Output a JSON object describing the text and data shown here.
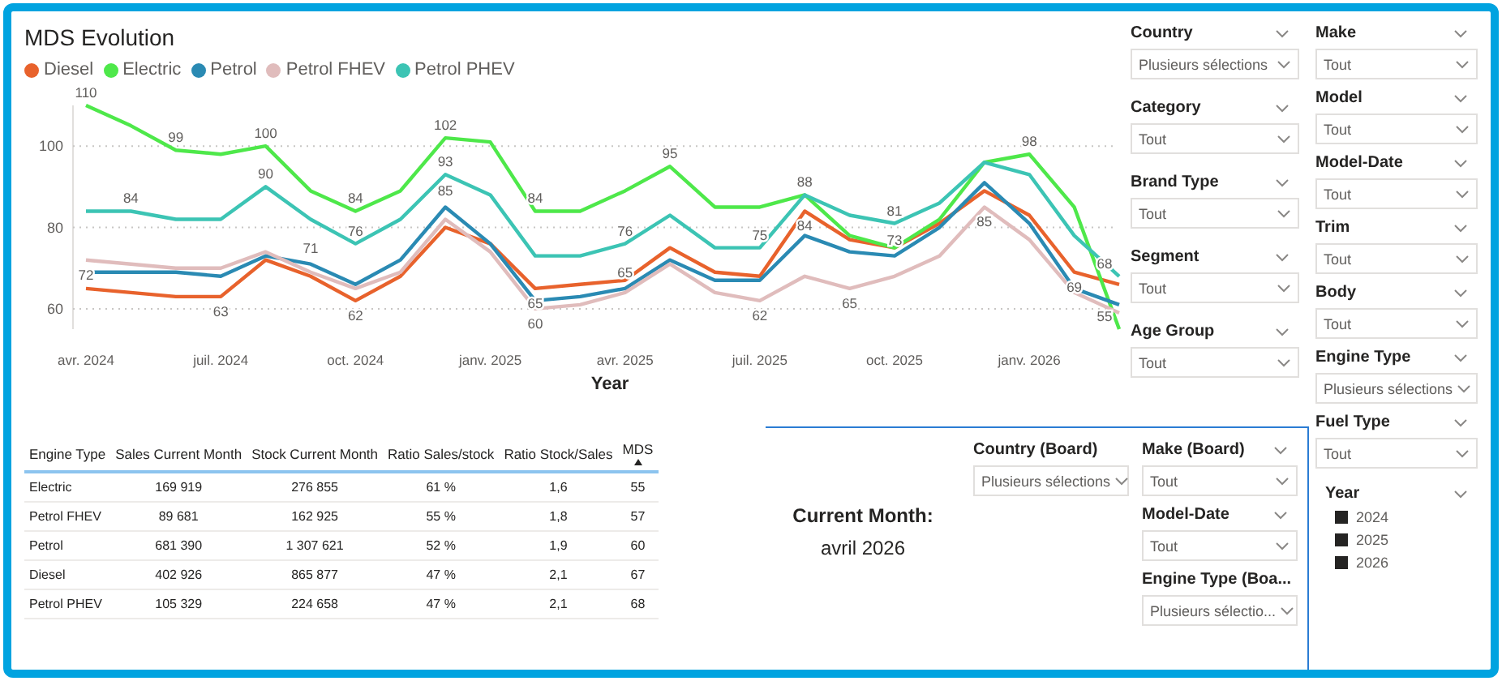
{
  "chart": {
    "title": "MDS Evolution",
    "chart_data": {
      "type": "line",
      "xlabel": "Year",
      "categories": [
        "avr. 2024",
        null,
        null,
        "juil. 2024",
        null,
        null,
        "oct. 2024",
        null,
        null,
        "janv. 2025",
        null,
        null,
        "avr. 2025",
        null,
        null,
        "juil. 2025",
        null,
        null,
        "oct. 2025",
        null,
        null,
        "janv. 2026",
        null,
        null
      ],
      "yticks": [
        60,
        80,
        100
      ],
      "ylim": [
        55,
        110
      ],
      "grid": true,
      "series": [
        {
          "name": "Diesel",
          "color": "#e8622c",
          "values": [
            65,
            64,
            63,
            63,
            72,
            68,
            62,
            68,
            80,
            76,
            65,
            66,
            67,
            75,
            69,
            68,
            84,
            77,
            75,
            81,
            89,
            83,
            69,
            66
          ],
          "value_labels": [
            null,
            null,
            null,
            "63",
            null,
            null,
            "62",
            null,
            null,
            null,
            "65",
            null,
            null,
            null,
            null,
            null,
            "84",
            null,
            null,
            null,
            null,
            null,
            "69",
            null
          ]
        },
        {
          "name": "Electric",
          "color": "#4ee84a",
          "values": [
            110,
            105,
            99,
            98,
            100,
            89,
            84,
            89,
            102,
            101,
            84,
            84,
            89,
            95,
            85,
            85,
            88,
            78,
            75,
            82,
            96,
            98,
            85,
            55
          ],
          "value_labels": [
            "110",
            null,
            "99",
            null,
            "100",
            null,
            "84",
            null,
            "102",
            null,
            "84",
            null,
            null,
            "95",
            null,
            null,
            "88",
            null,
            null,
            null,
            null,
            "98",
            null,
            "55"
          ]
        },
        {
          "name": "Petrol",
          "color": "#2a8ab3",
          "values": [
            69,
            69,
            69,
            68,
            73,
            71,
            66,
            72,
            85,
            76,
            62,
            63,
            65,
            72,
            67,
            67,
            78,
            74,
            73,
            80,
            91,
            81,
            65,
            61
          ],
          "value_labels": [
            null,
            null,
            null,
            null,
            null,
            "71",
            null,
            null,
            "85",
            null,
            null,
            null,
            "65",
            null,
            null,
            null,
            null,
            null,
            "73",
            null,
            null,
            null,
            null,
            null
          ]
        },
        {
          "name": "Petrol FHEV",
          "color": "#e0bcbc",
          "values": [
            72,
            71,
            70,
            70,
            74,
            69,
            65,
            69,
            82,
            74,
            60,
            61,
            64,
            71,
            64,
            62,
            68,
            65,
            68,
            73,
            85,
            77,
            64,
            59
          ],
          "value_labels": [
            "72",
            null,
            null,
            null,
            null,
            null,
            null,
            null,
            null,
            null,
            "60",
            null,
            null,
            null,
            null,
            "62",
            null,
            "65",
            null,
            null,
            "85",
            null,
            null,
            null
          ]
        },
        {
          "name": "Petrol PHEV",
          "color": "#3cc4b4",
          "values": [
            84,
            84,
            82,
            82,
            90,
            82,
            76,
            82,
            93,
            88,
            73,
            73,
            76,
            83,
            75,
            75,
            88,
            83,
            81,
            86,
            96,
            93,
            78,
            68
          ],
          "value_labels": [
            null,
            "84",
            null,
            null,
            "90",
            null,
            "76",
            null,
            "93",
            null,
            null,
            null,
            "76",
            null,
            null,
            "75",
            null,
            null,
            "81",
            null,
            null,
            null,
            null,
            "68"
          ]
        }
      ]
    }
  },
  "table": {
    "columns": [
      {
        "label": "Engine Type",
        "sorted": false
      },
      {
        "label": "Sales Current Month",
        "sorted": false
      },
      {
        "label": "Stock Current Month",
        "sorted": false
      },
      {
        "label": "Ratio Sales/stock",
        "sorted": false
      },
      {
        "label": "Ratio Stock/Sales",
        "sorted": false
      },
      {
        "label": "MDS",
        "sorted": true
      }
    ],
    "rows": [
      [
        "Electric",
        "169 919",
        "276 855",
        "61 %",
        "1,6",
        "55"
      ],
      [
        "Petrol FHEV",
        "89 681",
        "162 925",
        "55 %",
        "1,8",
        "57"
      ],
      [
        "Petrol",
        "681 390",
        "1 307 621",
        "52 %",
        "1,9",
        "60"
      ],
      [
        "Diesel",
        "402 926",
        "865 877",
        "47 %",
        "2,1",
        "67"
      ],
      [
        "Petrol PHEV",
        "105 329",
        "224 658",
        "47 %",
        "2,1",
        "68"
      ]
    ]
  },
  "current_month": {
    "label": "Current Month:",
    "value": "avril 2026"
  },
  "board_filters": [
    {
      "label": "Country (Board)",
      "value": "Plusieurs sélections",
      "chevron": false
    },
    {
      "label": "Make (Board)",
      "value": "Tout",
      "chevron": true
    },
    {
      "label": "Model-Date",
      "value": "Tout",
      "chevron": true
    },
    {
      "label": "Engine Type (Boa...",
      "value": "Plusieurs sélectio...",
      "chevron": false
    }
  ],
  "filters_left": [
    {
      "label": "Country",
      "value": "Plusieurs sélections",
      "chevron": true
    },
    {
      "label": "Category",
      "value": "Tout",
      "chevron": true
    },
    {
      "label": "Brand Type",
      "value": "Tout",
      "chevron": true
    },
    {
      "label": "Segment",
      "value": "Tout",
      "chevron": true
    },
    {
      "label": "Age Group",
      "value": "Tout",
      "chevron": true
    }
  ],
  "filters_right": [
    {
      "label": "Make",
      "value": "Tout",
      "chevron": true
    },
    {
      "label": "Model",
      "value": "Tout",
      "chevron": true
    },
    {
      "label": "Model-Date",
      "value": "Tout",
      "chevron": true
    },
    {
      "label": "Trim",
      "value": "Tout",
      "chevron": true
    },
    {
      "label": "Body",
      "value": "Tout",
      "chevron": true
    },
    {
      "label": "Engine Type",
      "value": "Plusieurs sélections",
      "chevron": true
    },
    {
      "label": "Fuel Type",
      "value": "Tout",
      "chevron": true
    }
  ],
  "year_filter": {
    "label": "Year",
    "chevron": true,
    "items": [
      {
        "label": "2024",
        "checked": true
      },
      {
        "label": "2025",
        "checked": true
      },
      {
        "label": "2026",
        "checked": true
      }
    ]
  }
}
